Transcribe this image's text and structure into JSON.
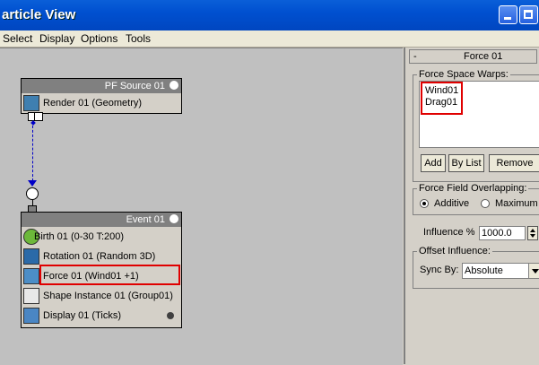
{
  "window": {
    "title": "article View"
  },
  "menu": [
    "Select",
    "Display",
    "Options",
    "Tools"
  ],
  "source_node": {
    "header": "PF Source 01",
    "rows": [
      "Render 01 (Geometry)"
    ]
  },
  "event_node": {
    "header": "Event 01",
    "rows": [
      "Birth 01 (0-30 T:200)",
      "Rotation 01 (Random 3D)",
      "Force 01 (Wind01 +1)",
      "Shape Instance 01 (Group01)",
      "Display 01 (Ticks)"
    ]
  },
  "panel": {
    "rollout_title": "Force 01",
    "rollout_sign": "-",
    "space_warps_label": "Force Space Warps:",
    "space_warps": [
      "Wind01",
      "Drag01"
    ],
    "add_button": "Add",
    "by_list_button": "By List",
    "remove_button": "Remove",
    "overlap_label": "Force Field Overlapping:",
    "additive_label": "Additive",
    "maximum_label": "Maximum",
    "influence_label": "Influence %",
    "influence_value": "1000.0",
    "offset_label": "Offset Influence:",
    "sync_label": "Sync By:",
    "sync_value": "Absolute"
  },
  "colors": {
    "highlight": "#e00000",
    "title_bar": "#0050d0",
    "canvas": "#c0c0c0"
  }
}
